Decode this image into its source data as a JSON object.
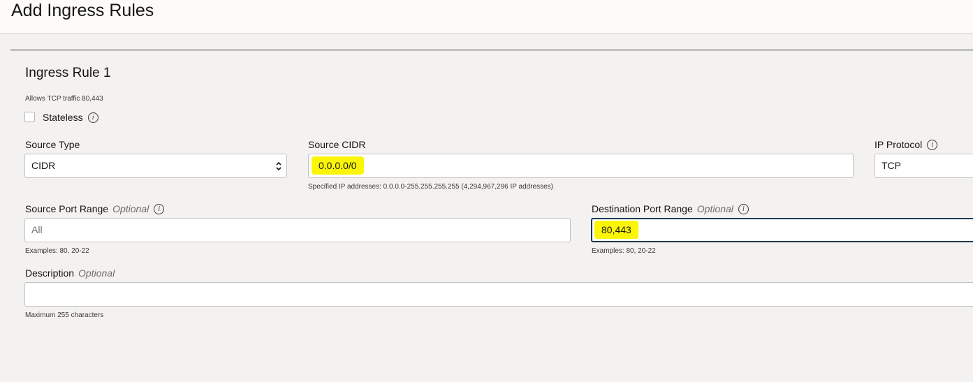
{
  "header": {
    "title": "Add Ingress Rules"
  },
  "rule": {
    "title": "Ingress Rule 1",
    "summary": "Allows TCP traffic 80,443",
    "stateless": {
      "label": "Stateless",
      "checked": false
    }
  },
  "fields": {
    "source_type": {
      "label": "Source Type",
      "value": "CIDR"
    },
    "source_cidr": {
      "label": "Source CIDR",
      "value": "0.0.0.0/0",
      "hint": "Specified IP addresses: 0.0.0.0-255.255.255.255 (4,294,967,296 IP addresses)"
    },
    "ip_protocol": {
      "label": "IP Protocol",
      "value": "TCP"
    },
    "source_port_range": {
      "label": "Source Port Range",
      "optional": "Optional",
      "placeholder": "All",
      "hint": "Examples: 80, 20-22"
    },
    "destination_port_range": {
      "label": "Destination Port Range",
      "optional": "Optional",
      "value": "80,443",
      "hint": "Examples: 80, 20-22"
    },
    "description": {
      "label": "Description",
      "optional": "Optional",
      "value": "",
      "hint": "Maximum 255 characters"
    }
  },
  "icons": {
    "info": "info-icon",
    "select": "chevron-up-down-icon"
  },
  "colors": {
    "highlight": "#fbf507",
    "focus_border": "#1b3a52",
    "background": "#f3f2f1"
  }
}
